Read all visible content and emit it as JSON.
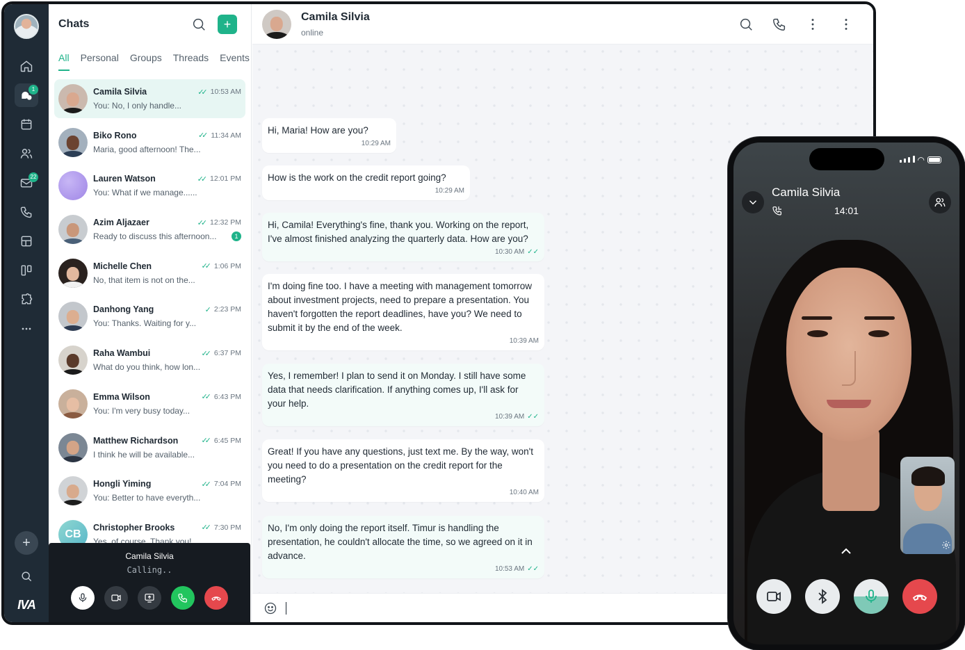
{
  "sidebar": {
    "items": [
      {
        "icon": "home-icon"
      },
      {
        "icon": "chats-icon",
        "badge": "1",
        "active": true
      },
      {
        "icon": "calendar-icon"
      },
      {
        "icon": "contacts-icon"
      },
      {
        "icon": "mail-icon",
        "badge": "22"
      },
      {
        "icon": "phone-icon"
      },
      {
        "icon": "layout-icon"
      },
      {
        "icon": "board-icon"
      },
      {
        "icon": "puzzle-icon"
      },
      {
        "icon": "more-icon"
      }
    ],
    "add_label": "+",
    "logo": "IVA"
  },
  "chatlist": {
    "title": "Chats",
    "new_label": "+",
    "tabs": [
      "All",
      "Personal",
      "Groups",
      "Threads",
      "Events"
    ],
    "items": [
      {
        "name": "Camila Silvia",
        "time": "10:53 AM",
        "prefix": "You: ",
        "msg": "No, I only handle...",
        "unread": ""
      },
      {
        "name": "Biko Rono",
        "time": "11:34 AM",
        "prefix": "",
        "msg": "Maria, good afternoon! The...",
        "unread": ""
      },
      {
        "name": "Lauren Watson",
        "time": "12:01 PM",
        "prefix": "You: ",
        "msg": "What if we manage......",
        "unread": ""
      },
      {
        "name": "Azim Aljazaer",
        "time": "12:32 PM",
        "prefix": "",
        "msg": "Ready to discuss this afternoon...",
        "unread": "1"
      },
      {
        "name": "Michelle Chen",
        "time": "1:06 PM",
        "prefix": "",
        "msg": "No, that item is not on the...",
        "unread": ""
      },
      {
        "name": "Danhong Yang",
        "time": "2:23 PM",
        "prefix": "You: ",
        "msg": "Thanks. Waiting for y...",
        "unread": ""
      },
      {
        "name": "Raha Wambui",
        "time": "6:37 PM",
        "prefix": "",
        "msg": "What do you think, how lon...",
        "unread": ""
      },
      {
        "name": "Emma Wilson",
        "time": "6:43 PM",
        "prefix": "You: ",
        "msg": "I'm very busy today...",
        "unread": ""
      },
      {
        "name": "Matthew Richardson",
        "time": "6:45 PM",
        "prefix": "",
        "msg": "I think he will be available...",
        "unread": ""
      },
      {
        "name": "Hongli Yiming",
        "time": "7:04 PM",
        "prefix": "You: ",
        "msg": "Better to have everyth...",
        "unread": ""
      },
      {
        "name": "Christopher Brooks",
        "time": "7:30 PM",
        "prefix": "",
        "msg": "Yes, of course. Thank you!",
        "unread": "",
        "initials": "CB"
      }
    ]
  },
  "calling_bar": {
    "name": "Camila Silvia",
    "status": "Calling.."
  },
  "conversation": {
    "name": "Camila Silvia",
    "status": "online",
    "messages": [
      {
        "text": "Hi, Maria! How are you?",
        "time": "10:29 AM",
        "dir": "in"
      },
      {
        "text": "How is the work on the credit report going?",
        "time": "10:29 AM",
        "dir": "in"
      },
      {
        "text": "Hi, Camila! Everything's fine, thank you. Working on the report, I've almost finished analyzing the quarterly data. How are you?",
        "time": "10:30 AM",
        "dir": "out"
      },
      {
        "text": "I'm doing fine too. I have a meeting with management tomorrow about investment projects, need to prepare a presentation. You haven't forgotten the report deadlines, have you? We need to submit it by the end of the week.",
        "time": "10:39 AM",
        "dir": "in"
      },
      {
        "text": "Yes, I remember! I plan to send it on Monday. I still have some data that needs clarification. If anything comes up, I'll ask for your help.",
        "time": "10:39 AM",
        "dir": "out"
      },
      {
        "text": "Great! If you have any questions, just text me. By the way, won't you need to do a presentation on the credit report for the meeting?",
        "time": "10:40 AM",
        "dir": "in"
      },
      {
        "text": "No, I'm only doing the report itself. Timur is handling the presentation, he couldn't allocate the time, so we agreed on it in advance.",
        "time": "10:53 AM",
        "dir": "out"
      }
    ]
  },
  "phone": {
    "caller": "Camila Silvia",
    "duration": "14:01",
    "controls": [
      "video-icon",
      "bluetooth-icon",
      "mic-icon",
      "hangup-icon"
    ]
  },
  "colors": {
    "accent": "#1fb38a",
    "rail": "#1f2b36",
    "hangup": "#e5484d"
  }
}
